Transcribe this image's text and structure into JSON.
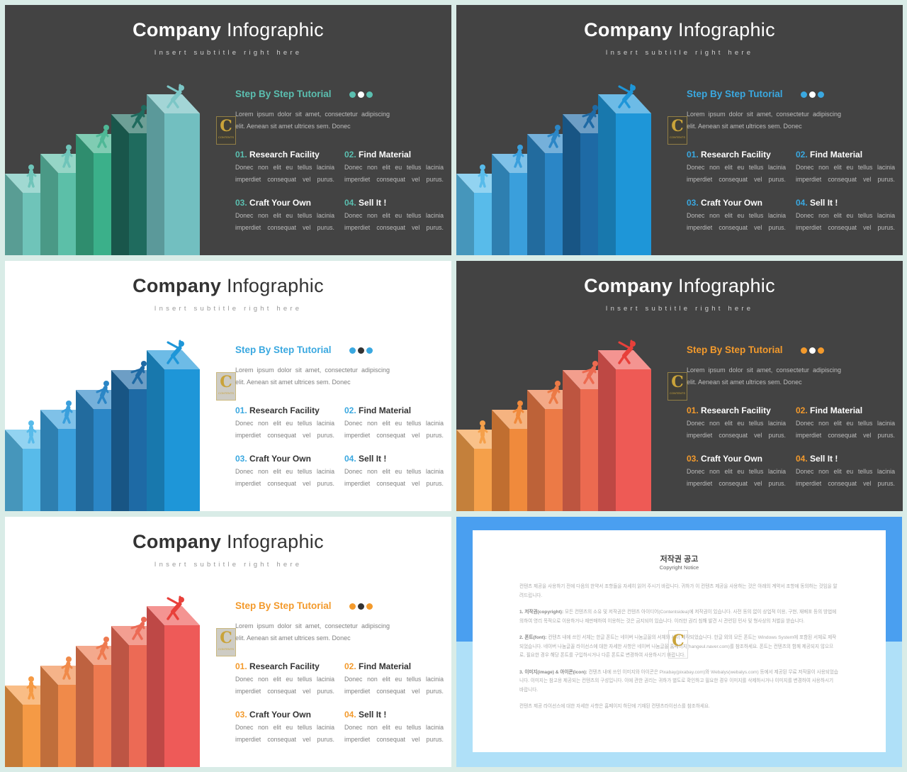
{
  "content": {
    "title_bold": "Company",
    "title_light": "Infographic",
    "subtitle": "Insert subtitle right here",
    "section_title": "Step By Step Tutorial",
    "intro": "Lorem ipsum dolor sit amet, consectetur adipiscing elit. Aenean sit amet ultrices sem. Donec",
    "items": [
      {
        "num": "01.",
        "title": "Research Facility",
        "body": "Donec non elit eu tellus lacinia imperdiet consequat vel purus."
      },
      {
        "num": "02.",
        "title": "Find Material",
        "body": "Donec non elit eu tellus lacinia imperdiet consequat vel purus."
      },
      {
        "num": "03.",
        "title": "Craft Your Own",
        "body": "Donec non elit eu tellus lacinia imperdiet consequat vel purus."
      },
      {
        "num": "04.",
        "title": "Sell It !",
        "body": "Donec non elit eu tellus lacinia imperdiet consequat vel purus."
      }
    ],
    "logo_text": "C",
    "logo_caption": "CONTENTS"
  },
  "slides": [
    {
      "theme": "dark",
      "accent": "#5bbfb0",
      "dots": [
        "#5bbfb0",
        "#ffffff",
        "#5bbfb0"
      ],
      "step_colors": [
        "#6fc4b9",
        "#5cbfa8",
        "#3bb08a",
        "#1f6b5e",
        "#72bfc0"
      ],
      "figure_colors": [
        "#6fc4b9",
        "#6fc4b9",
        "#4fb896",
        "#1f6b5e",
        "#7cc6c6"
      ]
    },
    {
      "theme": "dark",
      "accent": "#3aa8e0",
      "dots": [
        "#3aa8e0",
        "#ffffff",
        "#3aa8e0"
      ],
      "step_colors": [
        "#58bbea",
        "#3a9fdc",
        "#2b86c6",
        "#1e6aa5",
        "#1e96d8"
      ],
      "figure_colors": [
        "#58bbea",
        "#3a9fdc",
        "#2b86c6",
        "#1e6aa5",
        "#1e96d8"
      ]
    },
    {
      "theme": "light",
      "accent": "#3aa8e0",
      "dots": [
        "#3aa8e0",
        "#333333",
        "#3aa8e0"
      ],
      "step_colors": [
        "#58bbea",
        "#3a9fdc",
        "#2b86c6",
        "#1e6aa5",
        "#1e96d8"
      ],
      "figure_colors": [
        "#58bbea",
        "#3a9fdc",
        "#2b86c6",
        "#1e6aa5",
        "#1e96d8"
      ]
    },
    {
      "theme": "dark",
      "accent": "#f39a2c",
      "dots": [
        "#f39a2c",
        "#ffffff",
        "#f39a2c"
      ],
      "step_colors": [
        "#f5a04a",
        "#f08a3c",
        "#ec7a46",
        "#ec6a50",
        "#ee5a55"
      ],
      "figure_colors": [
        "#f5a04a",
        "#f08a3c",
        "#ec7a46",
        "#ec6a50",
        "#e8403a"
      ]
    },
    {
      "theme": "light",
      "accent": "#f39a2c",
      "dots": [
        "#f39a2c",
        "#333333",
        "#f39a2c"
      ],
      "step_colors": [
        "#f59a45",
        "#f08a4a",
        "#ee7a50",
        "#ec6a55",
        "#ee5a58"
      ],
      "figure_colors": [
        "#f59a45",
        "#f08a4a",
        "#ee7a50",
        "#ec6a55",
        "#e8403a"
      ]
    }
  ],
  "copyright": {
    "title": "저작권 공고",
    "subtitle": "Copyright Notice",
    "paragraphs": [
      {
        "label": "",
        "text": "컨텐츠 제공을 사용하기 전에 다음의 한약서 조항들을 자세히 읽어 주시기 바랍니다. 귀하가 이 컨텐츠 제공을 사용하는 것은 아래의 계약서 조항에 동의하는 것임을 알려드립니다."
      },
      {
        "label": "1. 저작권(copyright):",
        "text": "모든 컨텐츠의 소유 및 저작권은 컨텐츠 아이디어(Contentsidea)에 저작권이 있습니다. 사전 동의 없이 상업적 이용, 구현, 재배포 등의 방법에 의하여 영리 목적으로 이용하거나 재판매하여 이용하는 것은 금지되어 있습니다. 이러한 권리 침해 발견 시 관련된 민사 및 형사상의 처벌을 받습니다."
      },
      {
        "label": "2. 폰트(font):",
        "text": "컨텐츠 내에 쓰인 서체는 한글 폰트는 네이버 나눔글꼴의 서체와 사이 제작되었습니다. 한글 외의 모든 폰트는 Windows System에 포함된 서체로 제작되었습니다. 네이버 나눔글꼴 라이선스에 대한 자세한 사항은 네이버 나눔글꼴 홈페이지(hangeul.naver.com)를 참조하세요. 폰트는 컨텐츠의 함께 제공되지 않으므로, 필요한 경우 해당 폰트를 구입하시거나 다른 폰트로 변경하여 사용하시기 바랍니다."
      },
      {
        "label": "3. 이미지(image) & 아이콘(icon):",
        "text": "컨텐츠 내에 쓰인 이미지와 아이콘은 Pixabay(pixabay.com)와 Webalys(webalys.com) 등에서 제공된 무료 저작물이 사용되었습니다. 이미지는 참고용 제공되는 컨텐츠의 구성입니다. 이에 관한 권리는 귀하가 별도로 확인하고 필요한 경우 이미지를 삭제하시거나 이미지를 변경하여 사용하시기 바랍니다."
      },
      {
        "label": "",
        "text": "컨텐츠 제공 라이선스에 대한 자세한 사항은 홈페이지 하단에 기재된 컨텐츠라이선스를 참조하세요."
      }
    ]
  }
}
